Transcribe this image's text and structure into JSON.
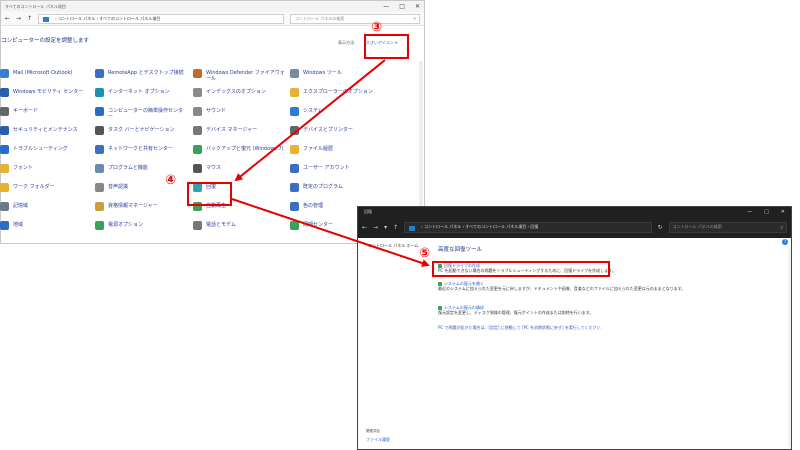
{
  "window1": {
    "title": "すべてのコントロール パネル項目",
    "controls": {
      "minimize": "—",
      "maximize": "□",
      "close": "✕"
    },
    "nav": {
      "back": "←",
      "forward": "→",
      "up": "↑"
    },
    "address": "› コントロール パネル › すべてのコントロール パネル項目",
    "search_placeholder": "コントロール パネルの検索",
    "page_title": "コンピューターの設定を調整します",
    "view_by_label": "表示方法:",
    "view_by_value": "大きいアイコン ▾",
    "items": [
      {
        "label": "Mail (Microsoft Outlook)",
        "icon": "mail-icon",
        "color": "#3b7bd4"
      },
      {
        "label": "RemoteApp とデスクトップ接続",
        "icon": "remoteapp-icon",
        "color": "#3a6fc4"
      },
      {
        "label": "Windows Defender ファイアウォール",
        "icon": "firewall-icon",
        "color": "#c86a2c"
      },
      {
        "label": "Windows ツール",
        "icon": "tools-icon",
        "color": "#7a8a9a"
      },
      {
        "label": "Windows モビリティ センター",
        "icon": "mobility-icon",
        "color": "#2a5fb0"
      },
      {
        "label": "インターネット オプション",
        "icon": "globe-icon",
        "color": "#1e90b0"
      },
      {
        "label": "インデックスのオプション",
        "icon": "index-icon",
        "color": "#8a8a8a"
      },
      {
        "label": "エクスプローラーのオプション",
        "icon": "folder-icon",
        "color": "#e5b233"
      },
      {
        "label": "キーボード",
        "icon": "keyboard-icon",
        "color": "#666"
      },
      {
        "label": "コンピューターの簡単操作センター",
        "icon": "ease-icon",
        "color": "#2a6cc8"
      },
      {
        "label": "サウンド",
        "icon": "sound-icon",
        "color": "#888"
      },
      {
        "label": "システム",
        "icon": "system-icon",
        "color": "#2b7cd3"
      },
      {
        "label": "セキュリティとメンテナンス",
        "icon": "flag-icon",
        "color": "#2a5fb0"
      },
      {
        "label": "タスク バーとナビゲーション",
        "icon": "taskbar-icon",
        "color": "#555"
      },
      {
        "label": "デバイス マネージャー",
        "icon": "devmgr-icon",
        "color": "#777"
      },
      {
        "label": "デバイスとプリンター",
        "icon": "printer-icon",
        "color": "#666"
      },
      {
        "label": "トラブルシューティング",
        "icon": "troubleshoot-icon",
        "color": "#2a6cc8"
      },
      {
        "label": "ネットワークと共有センター",
        "icon": "network-icon",
        "color": "#3a6fc4"
      },
      {
        "label": "バックアップと復元 (Windows 7)",
        "icon": "backup-icon",
        "color": "#3aa05a"
      },
      {
        "label": "ファイル履歴",
        "icon": "filehistory-icon",
        "color": "#e5b233"
      },
      {
        "label": "フォント",
        "icon": "font-icon",
        "color": "#e5b233"
      },
      {
        "label": "プログラムと機能",
        "icon": "programs-icon",
        "color": "#6a8ab0"
      },
      {
        "label": "マウス",
        "icon": "mouse-icon",
        "color": "#555"
      },
      {
        "label": "ユーザー アカウント",
        "icon": "user-icon",
        "color": "#3a6fc4"
      },
      {
        "label": "ワーク フォルダー",
        "icon": "workfolder-icon",
        "color": "#e5b233"
      },
      {
        "label": "音声認識",
        "icon": "mic-icon",
        "color": "#888"
      },
      {
        "label": "回復",
        "icon": "recovery-icon",
        "color": "#2aa7b0"
      },
      {
        "label": "既定のプログラム",
        "icon": "defaultprog-icon",
        "color": "#3a6fc4"
      },
      {
        "label": "記憶域",
        "icon": "storage-icon",
        "color": "#6a7a8a"
      },
      {
        "label": "資格情報マネージャー",
        "icon": "credential-icon",
        "color": "#c8a040"
      },
      {
        "label": "自動再生",
        "icon": "autoplay-icon",
        "color": "#3aa05a"
      },
      {
        "label": "色の管理",
        "icon": "color-icon",
        "color": "#3a6fc4"
      },
      {
        "label": "地域",
        "icon": "region-icon",
        "color": "#2a6cc8"
      },
      {
        "label": "電源オプション",
        "icon": "power-icon",
        "color": "#3aa05a"
      },
      {
        "label": "電話とモデム",
        "icon": "phone-icon",
        "color": "#777"
      },
      {
        "label": "同期センター",
        "icon": "sync-icon",
        "color": "#3aa05a"
      }
    ]
  },
  "window2": {
    "title": "回復",
    "controls": {
      "minimize": "—",
      "maximize": "□",
      "close": "✕"
    },
    "nav": {
      "back": "←",
      "forward": "→",
      "dropdown": "▾",
      "up": "↑",
      "refresh": "↻"
    },
    "address": "› コントロール パネル › すべてのコントロール パネル項目 › 回復",
    "search_placeholder": "コントロール パネルの検索",
    "left_link": "コントロール パネル ホーム",
    "heading": "高度な回復ツール",
    "options": [
      {
        "title": "回復ドライブの作成",
        "desc": "PC を起動できない場合の問題をトラブルシューティングするために、回復ドライブを作成します。"
      },
      {
        "title": "システムの復元を開く",
        "desc": "最近のシステムに加えられた変更を元に戻しますが、ドキュメントや画像、音楽などのファイルに加えられた変更は元のままとなります。"
      },
      {
        "title": "システムの復元の構成",
        "desc": "復元設定を変更し、ディスク領域の管理、復元ポイントの作成または削除を行います。"
      }
    ],
    "troubleshoot_link": "PC で問題が起きた場合は、[設定] に移動して [PC を初期状態に戻す] を実行してください",
    "see_also": "関連項目",
    "file_history": "ファイル履歴",
    "help": "?"
  },
  "annotations": {
    "step3": "③",
    "step4": "④",
    "step5": "⑤",
    "color": "#e60000"
  }
}
